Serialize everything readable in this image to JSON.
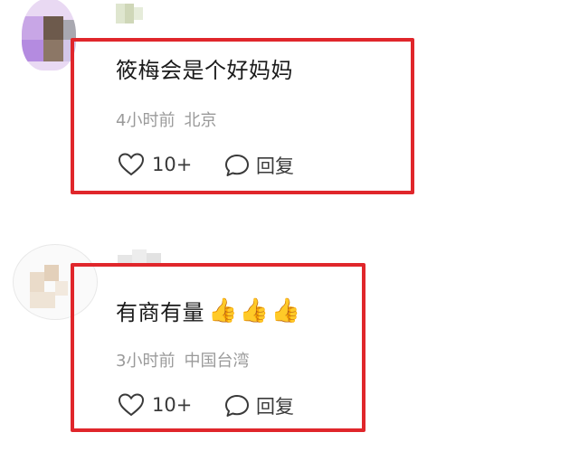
{
  "comments": [
    {
      "text": "筱梅会是个好妈妈",
      "time": "4小时前",
      "location": "北京",
      "likes": "10+",
      "reply_label": "回复"
    },
    {
      "text": "有商有量",
      "emoji": [
        "👍",
        "👍",
        "👍"
      ],
      "time": "3小时前",
      "location": "中国台湾",
      "likes": "10+",
      "reply_label": "回复"
    }
  ],
  "icons": {
    "like": "heart-outline-icon",
    "reply": "speech-bubble-icon",
    "reaction": "thumbs-up-emoji"
  },
  "colors": {
    "highlight_border": "#e0262b",
    "meta_text": "#9a9a9a",
    "body_text": "#1a1a1a"
  }
}
